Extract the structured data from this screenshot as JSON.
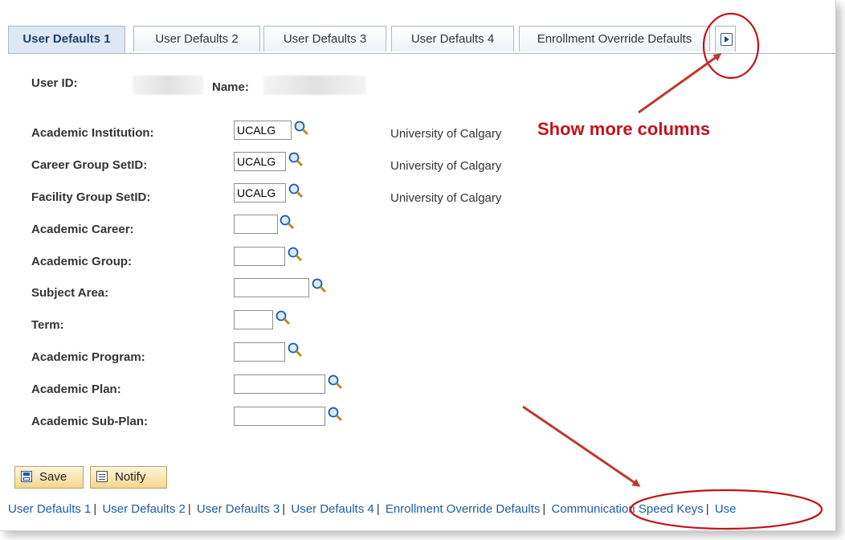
{
  "tabs": [
    {
      "label": "User Defaults 1",
      "active": true
    },
    {
      "label": "User Defaults 2",
      "active": false
    },
    {
      "label": "User Defaults 3",
      "active": false
    },
    {
      "label": "User Defaults 4",
      "active": false
    },
    {
      "label": "Enrollment Override Defaults",
      "active": false
    }
  ],
  "header": {
    "user_id_label": "User ID:",
    "name_label": "Name:"
  },
  "fields": [
    {
      "label": "Academic Institution:",
      "value": "UCALG",
      "desc": "University of Calgary"
    },
    {
      "label": "Career Group SetID:",
      "value": "UCALG",
      "desc": "University of Calgary"
    },
    {
      "label": "Facility Group SetID:",
      "value": "UCALG",
      "desc": "University of Calgary"
    },
    {
      "label": "Academic Career:",
      "value": "",
      "desc": ""
    },
    {
      "label": "Academic Group:",
      "value": "",
      "desc": ""
    },
    {
      "label": "Subject Area:",
      "value": "",
      "desc": ""
    },
    {
      "label": "Term:",
      "value": "",
      "desc": ""
    },
    {
      "label": "Academic Program:",
      "value": "",
      "desc": ""
    },
    {
      "label": "Academic Plan:",
      "value": "",
      "desc": ""
    },
    {
      "label": "Academic Sub-Plan:",
      "value": "",
      "desc": ""
    }
  ],
  "annotation": {
    "text": "Show more columns",
    "color": "#c0141a"
  },
  "buttons": {
    "save": "Save",
    "notify": "Notify"
  },
  "bottom_links": [
    "User Defaults 1",
    "User Defaults 2",
    "User Defaults 3",
    "User Defaults 4",
    "Enrollment Override Defaults",
    "Communication Speed Keys",
    "Use"
  ],
  "icons": {
    "lookup": "magnifier-icon",
    "more_tabs": "arrow-right-icon",
    "save": "floppy-disk-icon",
    "notify": "note-icon"
  }
}
